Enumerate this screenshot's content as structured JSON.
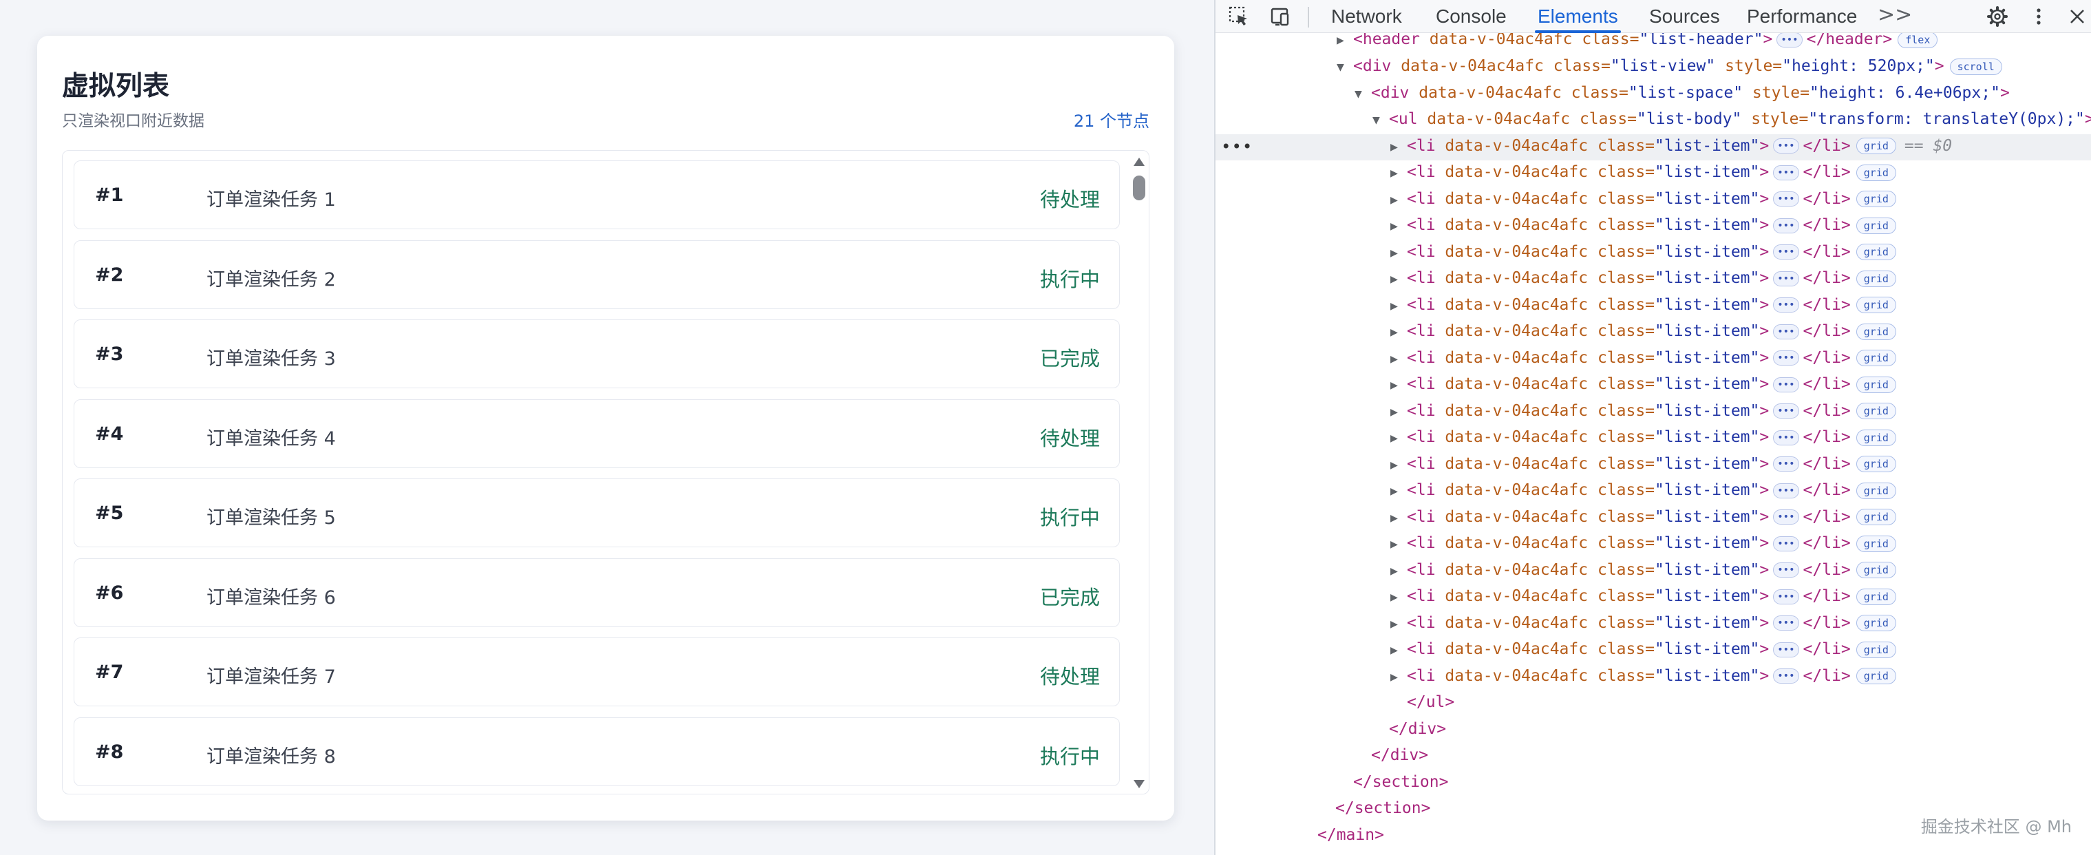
{
  "app": {
    "title": "虚拟列表",
    "subtitle": "只渲染视口附近数据",
    "node_count": "21 个节点",
    "items": [
      {
        "id": "#1",
        "name": "订单渲染任务 1",
        "status": "待处理"
      },
      {
        "id": "#2",
        "name": "订单渲染任务 2",
        "status": "执行中"
      },
      {
        "id": "#3",
        "name": "订单渲染任务 3",
        "status": "已完成"
      },
      {
        "id": "#4",
        "name": "订单渲染任务 4",
        "status": "待处理"
      },
      {
        "id": "#5",
        "name": "订单渲染任务 5",
        "status": "执行中"
      },
      {
        "id": "#6",
        "name": "订单渲染任务 6",
        "status": "已完成"
      },
      {
        "id": "#7",
        "name": "订单渲染任务 7",
        "status": "待处理"
      },
      {
        "id": "#8",
        "name": "订单渲染任务 8",
        "status": "执行中"
      }
    ]
  },
  "devtools": {
    "toolbar": {
      "tabs": [
        "Network",
        "Console",
        "Elements",
        "Sources",
        "Performance"
      ],
      "active_tab": "Elements",
      "overflow": ">>",
      "icons": [
        "inspect-element-icon",
        "device-toolbar-icon",
        "gear-icon",
        "more-vert-icon",
        "close-icon"
      ]
    },
    "tree": {
      "header_line": {
        "tag_open": "<header",
        "attr": " data-v-04ac4afc class=",
        "val": "\"list-header\"",
        "close": "</header>",
        "badge": "flex"
      },
      "list_view_line": {
        "tag_open": "<div",
        "attr": " data-v-04ac4afc class=",
        "val": "\"list-view\"",
        "style_attr": " style=",
        "style_val": "\"height: 520px;\"",
        "end": ">",
        "badge": "scroll"
      },
      "list_space_line": {
        "tag_open": "<div",
        "attr": " data-v-04ac4afc class=",
        "val": "\"list-space\"",
        "style_attr": " style=",
        "style_val": "\"height: 6.4e+06px;\"",
        "end": ">"
      },
      "list_body_line": {
        "tag_open": "<ul",
        "attr": " data-v-04ac4afc class=",
        "val": "\"list-body\"",
        "style_attr": " style=",
        "style_val": "\"transform: translateY(0px);\"",
        "end": ">"
      },
      "li": {
        "tag_open": "<li",
        "attr": " data-v-04ac4afc class=",
        "val": "\"list-item\"",
        "end": ">",
        "close": "</li>",
        "badge": "grid"
      },
      "li_count": 21,
      "selected_marker": "== $0",
      "closing": [
        "</ul>",
        "</div>",
        "</div>",
        "</section>",
        "</section>",
        "</main>"
      ]
    },
    "watermark": "掘金技术社区 @ Mh"
  },
  "colors": {
    "accent": "#1a64d6",
    "status_green": "#1d7a5a",
    "tag": "#a8277d",
    "attr_name": "#b65d1a",
    "attr_value": "#2135a4"
  }
}
